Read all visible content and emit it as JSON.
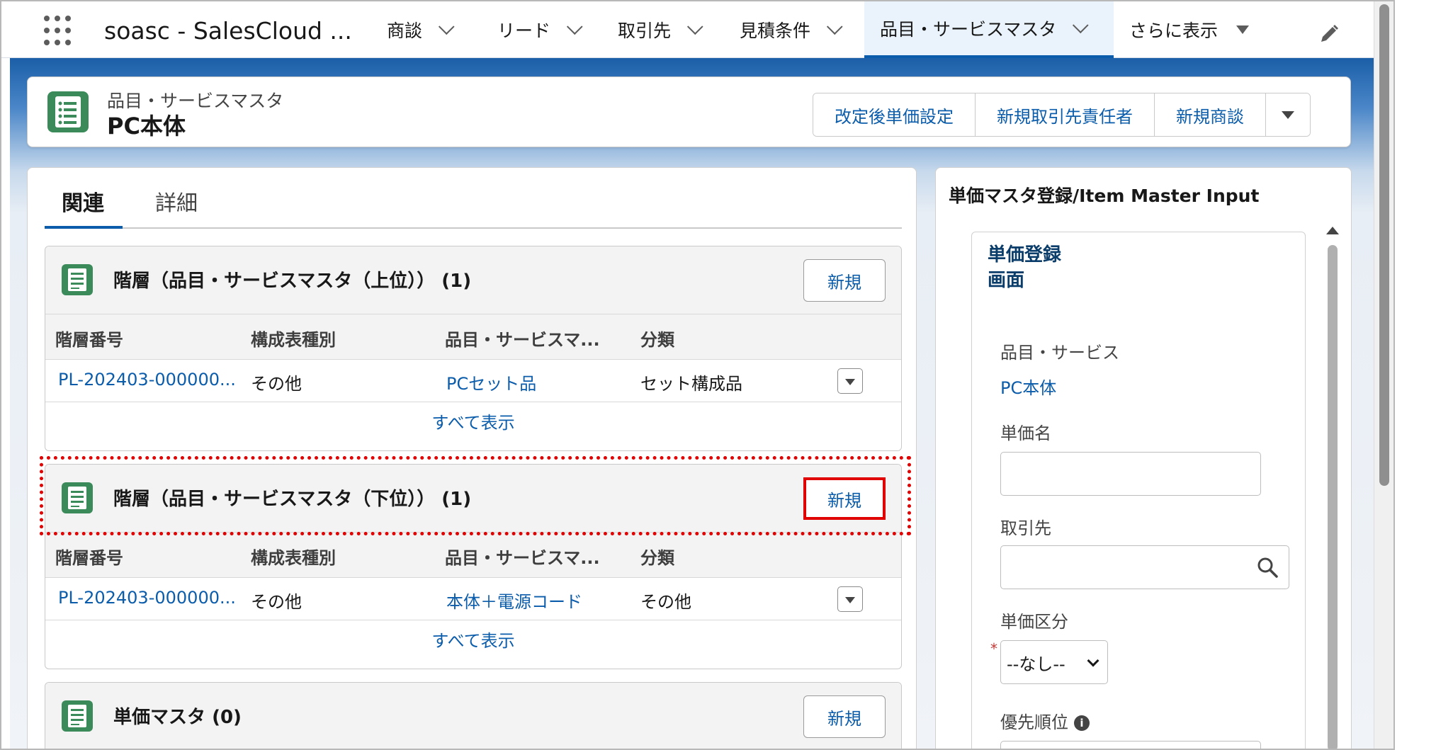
{
  "topnav": {
    "app_name": "soasc - SalesCloud ...",
    "items": [
      {
        "label": "商談"
      },
      {
        "label": "リード"
      },
      {
        "label": "取引先"
      },
      {
        "label": "見積条件"
      },
      {
        "label": "品目・サービスマスタ"
      },
      {
        "label": "さらに表示"
      }
    ]
  },
  "record": {
    "type_label": "品目・サービスマスタ",
    "name": "PC本体",
    "actions": {
      "revised_price": "改定後単価設定",
      "new_contact": "新規取引先責任者",
      "new_opportunity": "新規商談"
    }
  },
  "tabs": {
    "related": "関連",
    "details": "詳細"
  },
  "related_lists": [
    {
      "title": "階層（品目・サービスマスタ（上位））",
      "count": "(1)",
      "new_label": "新規",
      "columns": [
        "階層番号",
        "構成表種別",
        "品目・サービスマ...",
        "分類"
      ],
      "rows": [
        [
          "PL-202403-000000...",
          "その他",
          "PCセット品",
          "セット構成品"
        ]
      ],
      "view_all": "すべて表示"
    },
    {
      "title": "階層（品目・サービスマスタ（下位））",
      "count": "(1)",
      "new_label": "新規",
      "columns": [
        "階層番号",
        "構成表種別",
        "品目・サービスマ...",
        "分類"
      ],
      "rows": [
        [
          "PL-202403-000000...",
          "その他",
          "本体＋電源コード",
          "その他"
        ]
      ],
      "view_all": "すべて表示"
    },
    {
      "title": "単価マスタ",
      "count": "(0)",
      "new_label": "新規"
    }
  ],
  "right_panel": {
    "title": "単価マスタ登録/Item Master Input",
    "form_heading_line1": "単価登録",
    "form_heading_line2": "画面",
    "fields": {
      "item_label": "品目・サービス",
      "item_value": "PC本体",
      "price_name_label": "単価名",
      "price_name_value": "",
      "account_label": "取引先",
      "account_value": "",
      "price_type_label": "単価区分",
      "price_type_value": "--なし--",
      "priority_label": "優先順位",
      "required_mark": "*"
    }
  },
  "colors": {
    "brand_blue": "#0b5cab",
    "highlight_red": "#e00000",
    "band_blue": "#1b5fa8"
  },
  "icons": {
    "app_launcher": "waffle-grid-icon",
    "record": "list-document-icon",
    "edit": "pencil-icon",
    "search": "search-icon"
  }
}
